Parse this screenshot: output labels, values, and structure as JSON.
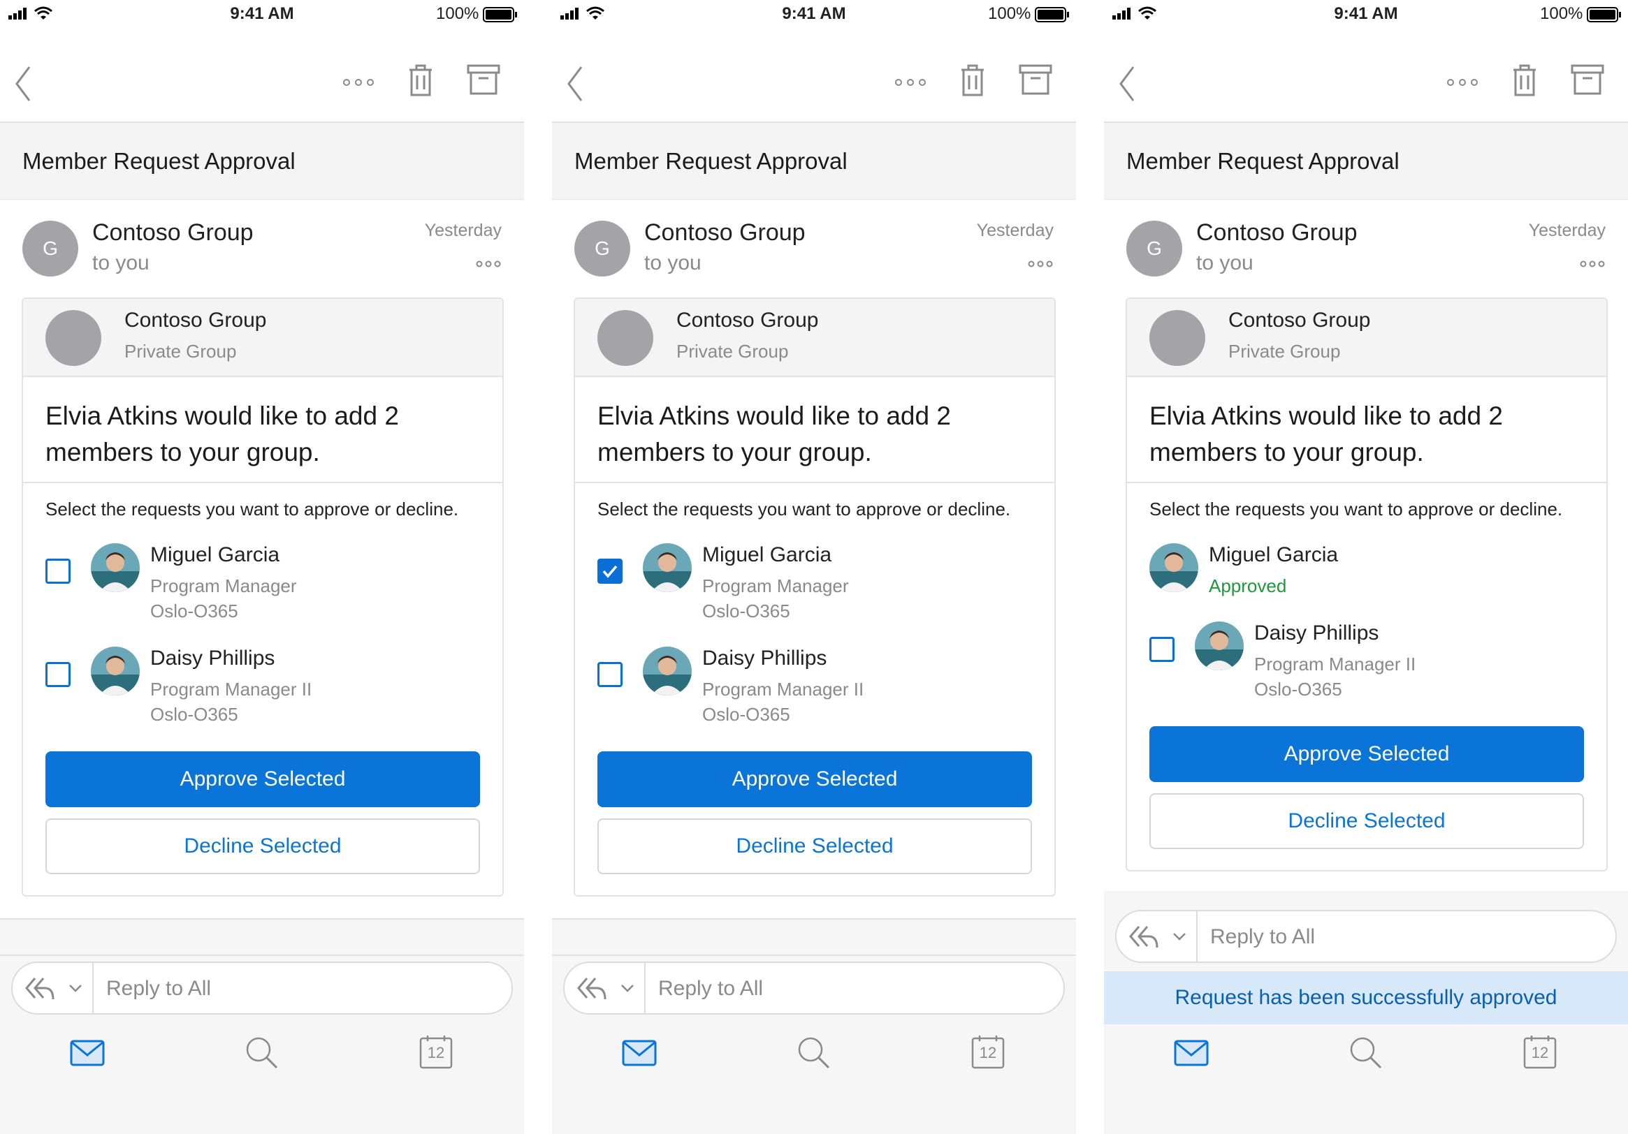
{
  "status_bar": {
    "time": "9:41 AM",
    "battery_pct": "100%"
  },
  "subject": "Member Request Approval",
  "sender": {
    "avatar_initial": "G",
    "name": "Contoso Group",
    "to": "to you",
    "date": "Yesterday"
  },
  "card": {
    "group_name": "Contoso Group",
    "group_type": "Private Group",
    "headline": "Elvia Atkins would like to add 2 members to your group.",
    "instruction": "Select the requests you want to approve or decline.",
    "approve_label": "Approve Selected",
    "decline_label": "Decline Selected"
  },
  "requests": [
    {
      "name": "Miguel Garcia",
      "title": "Program Manager",
      "location": "Oslo-O365"
    },
    {
      "name": "Daisy Phillips",
      "title": "Program Manager II",
      "location": "Oslo-O365"
    }
  ],
  "screens": [
    {
      "miguel_checked": false,
      "daisy_checked": false,
      "miguel_status": ""
    },
    {
      "miguel_checked": true,
      "daisy_checked": false,
      "miguel_status": ""
    },
    {
      "miguel_checked": false,
      "daisy_checked": false,
      "miguel_status": "Approved"
    }
  ],
  "reply": {
    "placeholder": "Reply to All"
  },
  "toast": "Request has been successfully approved",
  "tabbar": {
    "calendar_day": "12",
    "icons": [
      "mail-icon",
      "search-icon",
      "calendar-icon"
    ]
  },
  "colors": {
    "accent": "#0a74d8",
    "approved": "#1c9a3a",
    "toast_bg": "#d7e9f8"
  }
}
